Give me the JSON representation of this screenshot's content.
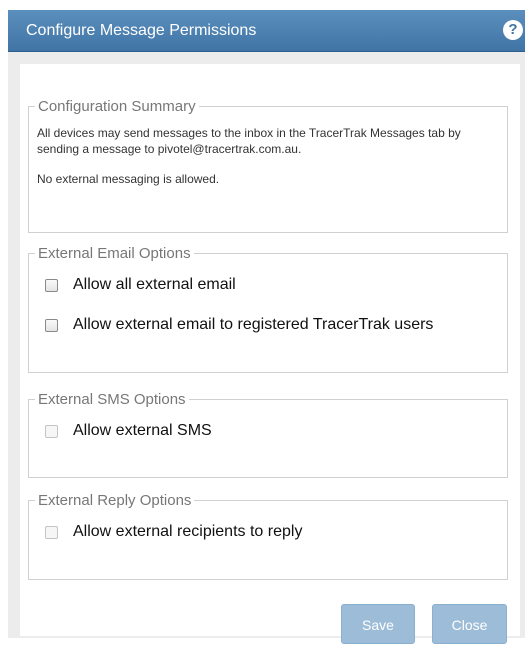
{
  "dialog": {
    "title": "Configure Message Permissions",
    "help_icon": "question-circle-icon"
  },
  "summary": {
    "legend": "Configuration Summary",
    "line1": "All devices may send messages to the inbox in the TracerTrak Messages tab by sending a message to pivotel@tracertrak.com.au.",
    "line2": "No external messaging is allowed."
  },
  "email_options": {
    "legend": "External Email Options",
    "allow_all": "Allow all external email",
    "allow_registered": "Allow external email to registered TracerTrak users"
  },
  "sms_options": {
    "legend": "External SMS Options",
    "allow_sms": "Allow external SMS"
  },
  "reply_options": {
    "legend": "External Reply Options",
    "allow_reply": "Allow external recipients to reply"
  },
  "buttons": {
    "save": "Save",
    "close": "Close"
  },
  "colors": {
    "titlebar": "#4a80b0",
    "button": "#9cbcd8"
  }
}
